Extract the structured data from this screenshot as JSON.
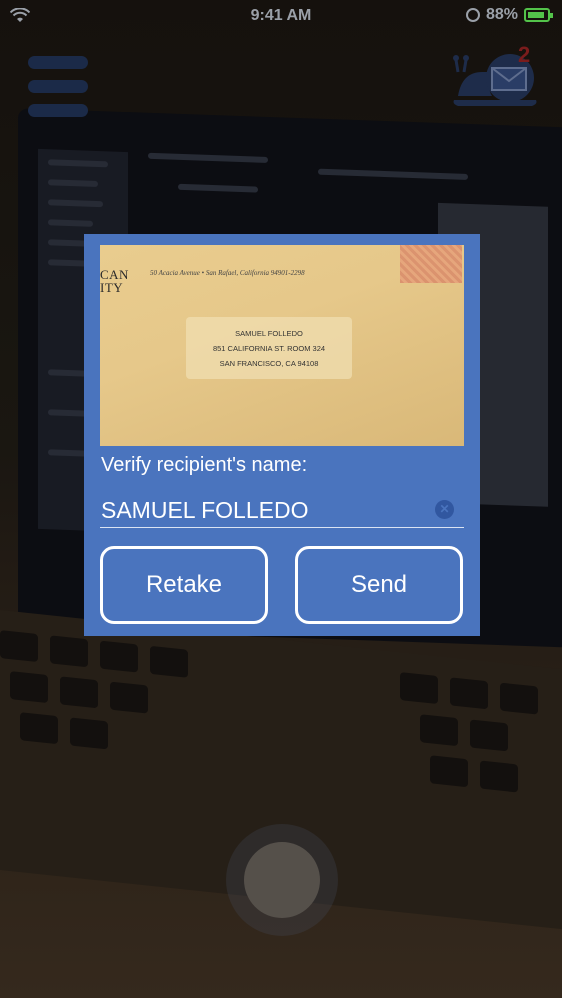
{
  "status_bar": {
    "time": "9:41 AM",
    "battery_percent": "88%",
    "battery_color": "#53c34a"
  },
  "top_bar": {
    "menu_icon": "hamburger-menu-icon",
    "badge_count": "2",
    "snail_icon": "snail-mail-icon"
  },
  "dialog": {
    "background_color": "#4a74be",
    "envelope": {
      "logo_lines": [
        "CAN",
        "ITY"
      ],
      "return_address": "50 Acacia Avenue • San Rafael, California 94901-2298",
      "recipient_lines": [
        "SAMUEL FOLLEDO",
        "851 CALIFORNIA ST. ROOM 324",
        "SAN FRANCISCO, CA 94108"
      ]
    },
    "verify_label": "Verify recipient's name:",
    "name_value": "SAMUEL FOLLEDO",
    "retake_label": "Retake",
    "send_label": "Send"
  }
}
